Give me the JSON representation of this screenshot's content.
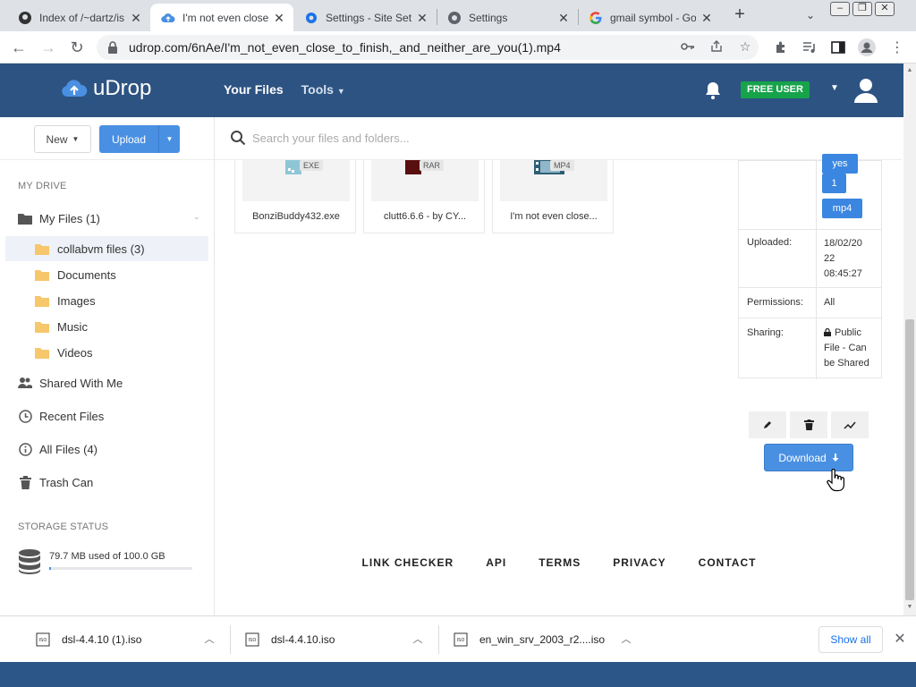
{
  "browser": {
    "tabs": [
      {
        "title": "Index of /~dartz/is",
        "icon": "github-favicon"
      },
      {
        "title": "I'm not even close t",
        "icon": "udrop-favicon",
        "active": true
      },
      {
        "title": "Settings - Site Setti",
        "icon": "settings-gear-favicon"
      },
      {
        "title": "Settings",
        "icon": "chrome-favicon"
      },
      {
        "title": "gmail symbol - Goo",
        "icon": "google-favicon"
      }
    ],
    "url": "udrop.com/6nAe/I'm_not_even_close_to_finish,_and_neither_are_you(1).mp4"
  },
  "site": {
    "logo_text": "uDrop",
    "nav_your_files": "Your Files",
    "nav_tools": "Tools",
    "user_badge": "FREE USER",
    "brand_color": "#2d5382",
    "accent_color": "#4a90e2"
  },
  "sidebar": {
    "new_label": "New",
    "upload_label": "Upload",
    "my_drive_heading": "MY DRIVE",
    "my_files": "My Files (1)",
    "folders": [
      {
        "label": "collabvm files (3)",
        "selected": true
      },
      {
        "label": "Documents"
      },
      {
        "label": "Images"
      },
      {
        "label": "Music"
      },
      {
        "label": "Videos"
      }
    ],
    "shared_with_me": "Shared With Me",
    "recent_files": "Recent Files",
    "all_files": "All Files (4)",
    "trash_can": "Trash Can",
    "storage_heading": "STORAGE STATUS",
    "storage_text": "79.7 MB used of 100.0 GB",
    "storage_used_fraction": 0.0008
  },
  "search": {
    "placeholder": "Search your files and folders..."
  },
  "files": [
    {
      "name": "BonziBuddy432.exe",
      "type": "EXE"
    },
    {
      "name": "clutt6.6.6 - by CY...",
      "type": "RAR"
    },
    {
      "name": "I'm not even close...",
      "type": "MP4"
    }
  ],
  "details": {
    "tags": [
      "yes",
      "1",
      "mp4"
    ],
    "uploaded_label": "Uploaded:",
    "uploaded_value": "18/02/2022 08:45:27",
    "uploaded_lines": [
      "18/02/20",
      "22",
      "08:45:27"
    ],
    "permissions_label": "Permissions:",
    "permissions_value": "All",
    "sharing_label": "Sharing:",
    "sharing_lines": [
      "Public",
      "File - Can",
      "be Shared"
    ]
  },
  "actions": {
    "download_label": "Download"
  },
  "footer": {
    "links": [
      "LINK CHECKER",
      "API",
      "TERMS",
      "PRIVACY",
      "CONTACT"
    ]
  },
  "downloads": {
    "items": [
      "dsl-4.4.10 (1).iso",
      "dsl-4.4.10.iso",
      "en_win_srv_2003_r2....iso"
    ],
    "show_all": "Show all"
  }
}
